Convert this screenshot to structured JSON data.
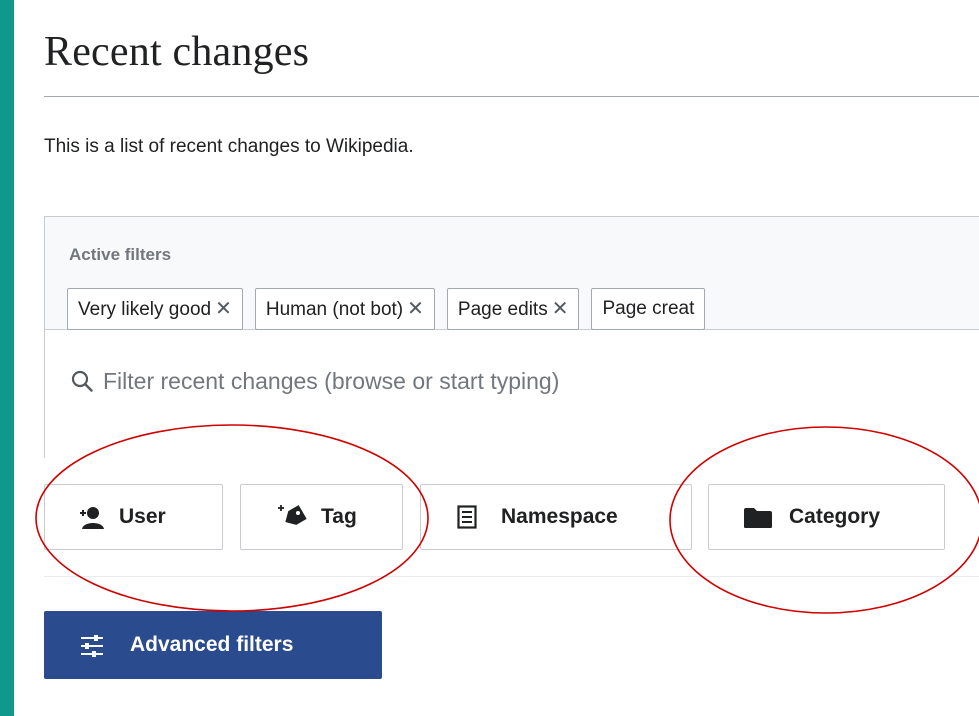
{
  "page": {
    "title": "Recent changes",
    "intro": "This is a list of recent changes to Wikipedia."
  },
  "filters": {
    "active_label": "Active filters",
    "chips": [
      {
        "label": "Very likely good",
        "remove": "✕"
      },
      {
        "label": "Human (not bot)",
        "remove": "✕"
      },
      {
        "label": "Page edits",
        "remove": "✕"
      },
      {
        "label": "Page creat"
      }
    ],
    "search": {
      "placeholder": "Filter recent changes (browse or start typing)"
    }
  },
  "quick_filters": [
    {
      "label": "User",
      "icon": "user-add-icon"
    },
    {
      "label": "Tag",
      "icon": "tag-add-icon"
    },
    {
      "label": "Namespace",
      "icon": "namespace-icon"
    },
    {
      "label": "Category",
      "icon": "folder-icon"
    }
  ],
  "advanced": {
    "label": "Advanced filters",
    "icon": "sliders-icon"
  },
  "colors": {
    "frame": "#10988a",
    "primary_button": "#2a4b8d",
    "annotation_ring": "#d00000"
  }
}
